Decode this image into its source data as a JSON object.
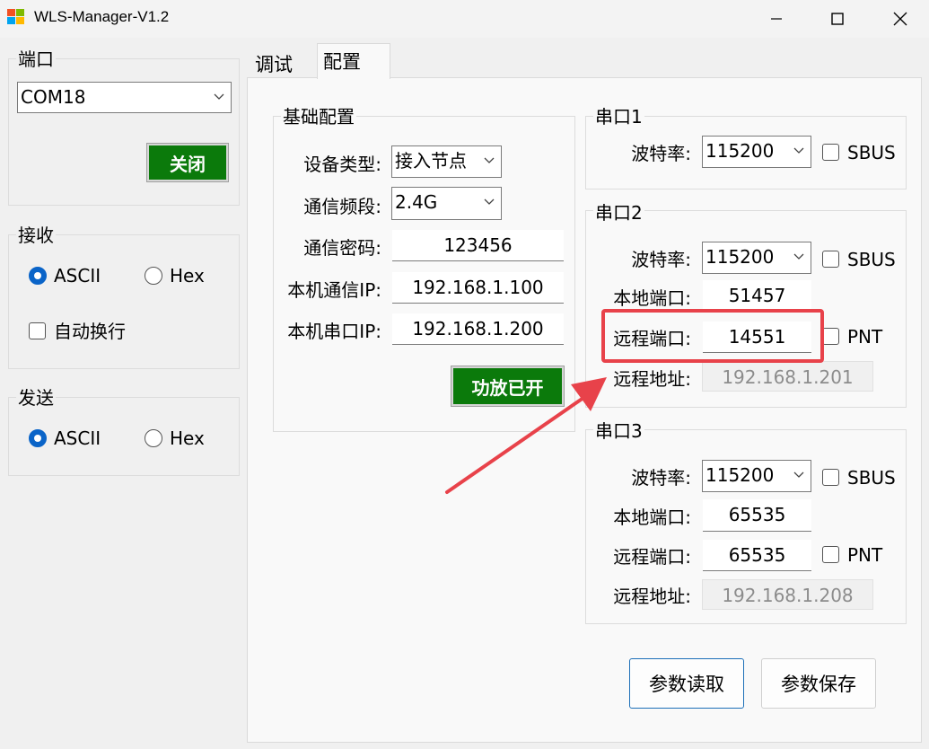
{
  "window": {
    "title": "WLS-Manager-V1.2"
  },
  "port": {
    "group_label": "端口",
    "selected": "COM18",
    "close_button": "关闭"
  },
  "receive": {
    "group_label": "接收",
    "ascii_label": "ASCII",
    "hex_label": "Hex",
    "autowrap_label": "自动换行",
    "mode": "ASCII"
  },
  "send": {
    "group_label": "发送",
    "ascii_label": "ASCII",
    "hex_label": "Hex",
    "mode": "ASCII"
  },
  "tabs": [
    {
      "label": "调试"
    },
    {
      "label": "配置"
    }
  ],
  "active_tab": "配置",
  "basic": {
    "group_label": "基础配置",
    "device_type_label": "设备类型:",
    "device_type_value": "接入节点",
    "band_label": "通信频段:",
    "band_value": "2.4G",
    "password_label": "通信密码:",
    "password_value": "123456",
    "local_ip_label": "本机通信IP:",
    "local_ip_value": "192.168.1.100",
    "serial_ip_label": "本机串口IP:",
    "serial_ip_value": "192.168.1.200",
    "amp_button": "功放已开"
  },
  "serial1": {
    "group_label": "串口1",
    "baud_label": "波特率:",
    "baud_value": "115200",
    "sbus_label": "SBUS"
  },
  "serial2": {
    "group_label": "串口2",
    "baud_label": "波特率:",
    "baud_value": "115200",
    "sbus_label": "SBUS",
    "local_port_label": "本地端口:",
    "local_port_value": "51457",
    "remote_port_label": "远程端口:",
    "remote_port_value": "14551",
    "pnt_label": "PNT",
    "remote_addr_label": "远程地址:",
    "remote_addr_value": "192.168.1.201"
  },
  "serial3": {
    "group_label": "串口3",
    "baud_label": "波特率:",
    "baud_value": "115200",
    "sbus_label": "SBUS",
    "local_port_label": "本地端口:",
    "local_port_value": "65535",
    "remote_port_label": "远程端口:",
    "remote_port_value": "65535",
    "pnt_label": "PNT",
    "remote_addr_label": "远程地址:",
    "remote_addr_value": "192.168.1.208"
  },
  "actions": {
    "read_button": "参数读取",
    "save_button": "参数保存"
  },
  "colors": {
    "accent_green": "#0b7a0b",
    "radio_blue": "#0a64c8",
    "highlight_red": "#e8424a"
  }
}
